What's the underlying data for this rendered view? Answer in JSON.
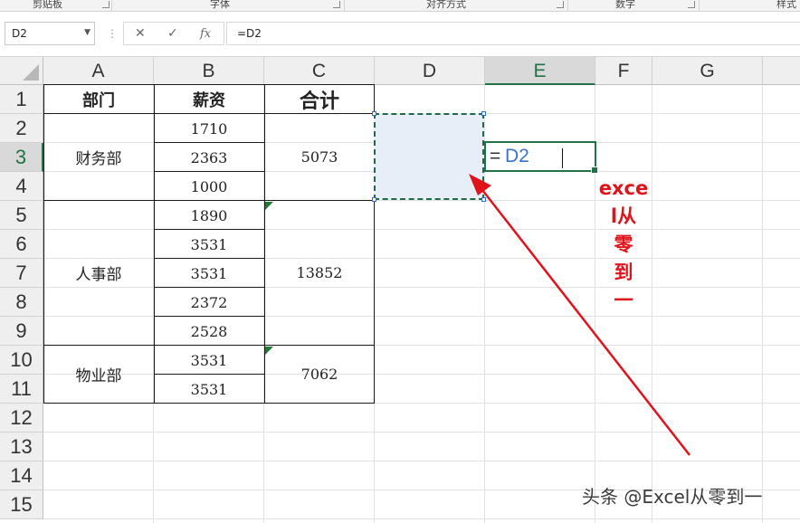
{
  "ribbon": {
    "groups": [
      "剪贴板",
      "字体",
      "对齐方式",
      "数字",
      "样式"
    ]
  },
  "formula_bar": {
    "name_box": "D2",
    "cancel_icon": "✕",
    "enter_icon": "✓",
    "fx_label": "fx",
    "formula": "=D2"
  },
  "columns": [
    "A",
    "B",
    "C",
    "D",
    "E",
    "F",
    "G"
  ],
  "selected_column": "E",
  "rows": [
    "1",
    "2",
    "3",
    "4",
    "5",
    "6",
    "7",
    "8",
    "9",
    "10",
    "11",
    "12",
    "13",
    "14",
    "15"
  ],
  "selected_row": "3",
  "table": {
    "header_dept": "部门",
    "header_salary": "薪资",
    "header_total": "合计",
    "groups": [
      {
        "dept": "财务部",
        "salaries": [
          "1710",
          "2363",
          "1000"
        ],
        "total": "5073"
      },
      {
        "dept": "人事部",
        "salaries": [
          "1890",
          "3531",
          "3531",
          "2372",
          "2528"
        ],
        "total": "13852"
      },
      {
        "dept": "物业部",
        "salaries": [
          "3531",
          "3531"
        ],
        "total": "7062"
      }
    ]
  },
  "edit_cell": {
    "equals": "=",
    "reference": "D2"
  },
  "annotation": {
    "lines": [
      "exce",
      "l从",
      "零",
      "到",
      "一"
    ],
    "color": "#e0131b"
  },
  "watermark": "头条 @Excel从零到一",
  "colors": {
    "accent": "#217346",
    "reference_blue": "#3a73c8",
    "selection_fill": "#e8eef8",
    "arrow": "#e0131b"
  }
}
